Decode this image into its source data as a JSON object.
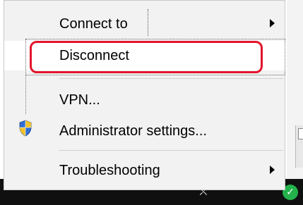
{
  "menu": {
    "items": [
      {
        "label": "Connect to",
        "has_submenu": true
      },
      {
        "label": "Disconnect",
        "has_submenu": false,
        "highlighted": true
      },
      {
        "label": "VPN...",
        "has_submenu": false
      },
      {
        "label": "Administrator settings...",
        "has_submenu": false,
        "icon": "shield-icon"
      },
      {
        "label": "Troubleshooting",
        "has_submenu": true
      }
    ]
  },
  "colors": {
    "menu_background": "#f2f2f2",
    "highlight_annotation": "#e2152b",
    "taskbar": "#101010",
    "network_icon": "#23b24b"
  },
  "taskbar": {
    "icons": [
      "person-icon",
      "chevron-up-icon",
      "network-icon"
    ]
  }
}
